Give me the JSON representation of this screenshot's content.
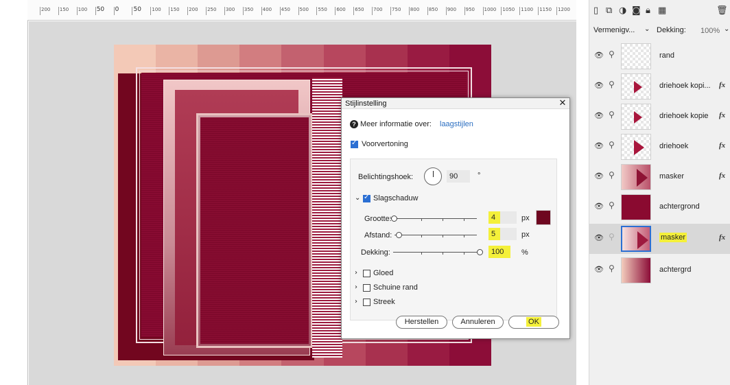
{
  "ruler": {
    "labels": [
      "200",
      "150",
      "100",
      "50",
      "0",
      "50",
      "100",
      "150",
      "200",
      "250",
      "300",
      "350",
      "400",
      "450",
      "500",
      "550",
      "600",
      "650",
      "700",
      "750",
      "800",
      "850",
      "900",
      "950",
      "1000",
      "1050",
      "1100",
      "1150",
      "1200"
    ]
  },
  "colors": {
    "canvas_bg": "#d9d9d9",
    "artwork_stripes": [
      "#f3c9b7",
      "#eab4a5",
      "#dd9a92",
      "#d27d80",
      "#c3616f",
      "#b7475e",
      "#a8314f",
      "#991b42",
      "#8c0d38"
    ],
    "shadow_color": "#6e0720",
    "highlight": "#f4f03a",
    "link_blue": "#2a6ec1"
  },
  "dialog": {
    "title": "Stijlinstelling",
    "close_glyph": "✕",
    "more_info_label": "Meer informatie over:",
    "more_info_link": "laagstijlen",
    "preview_label": "Voorvertoning",
    "preview_checked": true,
    "angle_label": "Belichtingshoek:",
    "angle_value": "90",
    "angle_unit": "°",
    "drop_shadow_label": "Slagschaduw",
    "drop_shadow_checked": true,
    "size_label": "Grootte:",
    "size_value": "4",
    "size_unit": "px",
    "size_level": 0.04,
    "distance_label": "Afstand:",
    "distance_value": "5",
    "distance_unit": "px",
    "distance_level": 0.05,
    "opacity_label": "Dekking:",
    "opacity_value": "100",
    "opacity_unit": "%",
    "opacity_level": 1.0,
    "glow_label": "Gloed",
    "bevel_label": "Schuine rand",
    "stroke_label": "Streek",
    "reset_button": "Herstellen",
    "cancel_button": "Annuleren",
    "ok_button": "OK"
  },
  "panel": {
    "blend_mode": "Vermenigv...",
    "opacity_label": "Dekking:",
    "opacity_value": "100%",
    "layers": [
      {
        "name": "rand",
        "fx": "",
        "thumb": "transparent",
        "selected": false
      },
      {
        "name": "driehoek kopi...",
        "fx": "fx",
        "thumb": "triangle",
        "selected": false
      },
      {
        "name": "driehoek kopie",
        "fx": "fx",
        "thumb": "triangle",
        "selected": false
      },
      {
        "name": "driehoek",
        "fx": "fx",
        "thumb": "triangle-large",
        "selected": false
      },
      {
        "name": "masker",
        "fx": "fx",
        "thumb": "mask",
        "selected": false
      },
      {
        "name": "achtergrond",
        "fx": "",
        "thumb": "solid",
        "selected": false
      },
      {
        "name": "masker",
        "fx": "fx",
        "thumb": "mask",
        "selected": true
      },
      {
        "name": "achtergrd",
        "fx": "",
        "thumb": "gradient",
        "selected": false
      }
    ]
  }
}
